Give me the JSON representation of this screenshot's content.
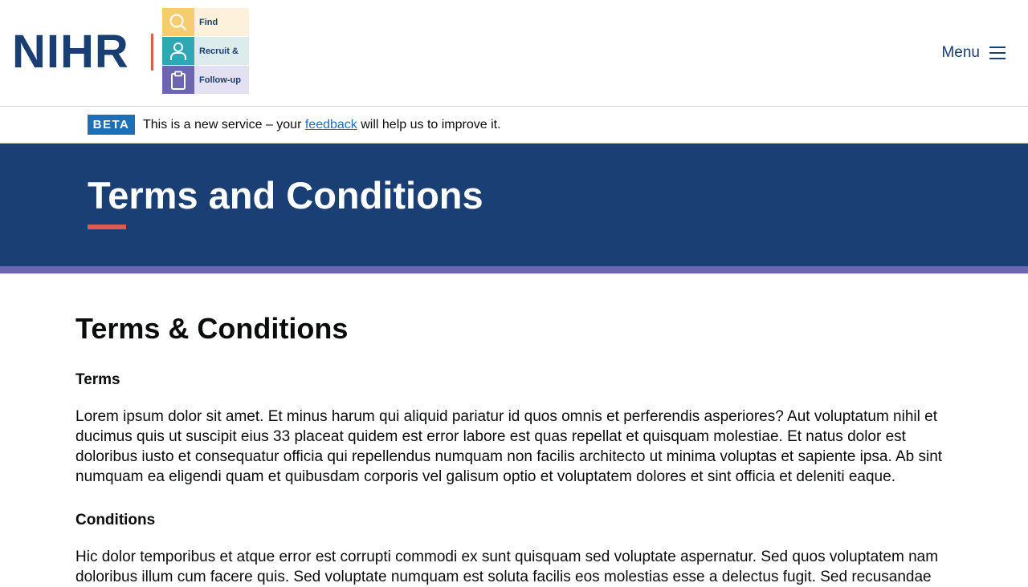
{
  "header": {
    "logo_text": "NIHR",
    "logo_rows": [
      {
        "icon": "search-icon",
        "label": "Find"
      },
      {
        "icon": "person-icon",
        "label": "Recruit &"
      },
      {
        "icon": "clipboard-icon",
        "label": "Follow-up"
      }
    ],
    "menu_label": "Menu"
  },
  "beta": {
    "tag": "BETA",
    "text_before": "This is a new service – your ",
    "link": "feedback",
    "text_after": " will help us to improve it."
  },
  "hero": {
    "title": "Terms and Conditions"
  },
  "main": {
    "heading": "Terms & Conditions",
    "sections": [
      {
        "title": "Terms",
        "body": "Lorem ipsum dolor sit amet. Et minus harum qui aliquid pariatur id quos omnis et perferendis asperiores? Aut voluptatum nihil et ducimus quis ut suscipit eius 33 placeat quidem est error labore est quas repellat et quisquam molestiae. Et natus dolor est doloribus iusto et consequatur officia qui repellendus numquam non facilis architecto ut minima voluptas et sapiente ipsa. Ab sint numquam ea eligendi quam et quibusdam corporis vel galisum optio et voluptatem dolores et sint officia et deleniti eaque."
      },
      {
        "title": "Conditions",
        "body": "Hic dolor temporibus et atque error est corrupti commodi ex sunt quisquam sed voluptate aspernatur. Sed quos voluptatem nam doloribus illum cum facere quis. Sed voluptate numquam est soluta facilis eos molestias esse a delectus fugit. Sed recusandae"
      }
    ]
  },
  "colors": {
    "brand_navy": "#1a3f74",
    "accent_red": "#e05b4e",
    "accent_purple": "#6c66b1",
    "link_blue": "#1d70b8"
  }
}
